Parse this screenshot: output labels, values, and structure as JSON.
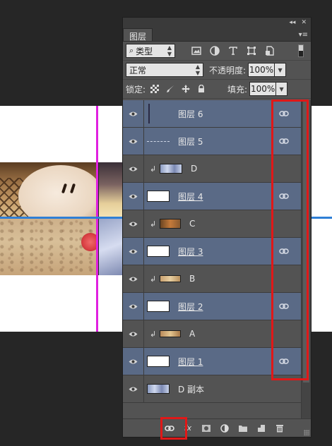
{
  "panel": {
    "tab_label": "图层",
    "collapse_icon": "◂◂",
    "close_icon": "✕",
    "menu_icon": "▾≡"
  },
  "filter": {
    "kind_label": "类型",
    "kind_icon": "search-icon",
    "filter_icons": [
      "image-filter-icon",
      "adjustment-filter-icon",
      "type-filter-icon",
      "shape-filter-icon",
      "smart-object-filter-icon"
    ]
  },
  "blend": {
    "mode": "正常",
    "opacity_label": "不透明度:",
    "opacity_value": "100%"
  },
  "lock": {
    "label": "锁定:",
    "fill_label": "填充:",
    "fill_value": "100%"
  },
  "layers": [
    {
      "name": "图层 6",
      "thumb": "vline",
      "selected": true,
      "linked": true,
      "clipped": false,
      "underline": false
    },
    {
      "name": "图层 5",
      "thumb": "line",
      "selected": true,
      "linked": true,
      "clipped": false,
      "underline": false
    },
    {
      "name": "D",
      "thumb": "img-blue",
      "selected": false,
      "linked": false,
      "clipped": true,
      "underline": false
    },
    {
      "name": "图层 4",
      "thumb": "white",
      "selected": true,
      "linked": true,
      "clipped": false,
      "underline": true
    },
    {
      "name": "C",
      "thumb": "img-brown",
      "selected": false,
      "linked": false,
      "clipped": true,
      "underline": false
    },
    {
      "name": "图层 3",
      "thumb": "white",
      "selected": true,
      "linked": true,
      "clipped": false,
      "underline": true
    },
    {
      "name": "B",
      "thumb": "img-sand",
      "selected": false,
      "linked": false,
      "clipped": true,
      "underline": false
    },
    {
      "name": "图层 2",
      "thumb": "white",
      "selected": true,
      "linked": true,
      "clipped": false,
      "underline": true
    },
    {
      "name": "A",
      "thumb": "img-beach",
      "selected": false,
      "linked": false,
      "clipped": true,
      "underline": false
    },
    {
      "name": "图层 1",
      "thumb": "white",
      "selected": true,
      "linked": true,
      "clipped": false,
      "underline": true
    },
    {
      "name": "D 副本",
      "thumb": "img-blue",
      "selected": false,
      "linked": false,
      "clipped": false,
      "underline": false
    }
  ],
  "bottom_buttons": [
    {
      "name": "link-layers-button",
      "glyph": "link-icon"
    },
    {
      "name": "fx-button",
      "glyph": "fx"
    },
    {
      "name": "add-mask-button",
      "glyph": "mask-icon"
    },
    {
      "name": "new-adjustment-button",
      "glyph": "adjustment-icon"
    },
    {
      "name": "new-group-button",
      "glyph": "folder-icon"
    },
    {
      "name": "new-layer-button",
      "glyph": "new-layer-icon"
    },
    {
      "name": "delete-layer-button",
      "glyph": "trash-icon"
    }
  ],
  "colors": {
    "highlight": "#e01818",
    "selected_row": "#5a6a86",
    "panel_bg": "#535353",
    "guide_magenta": "#e020e0",
    "guide_blue": "#2f7fd6"
  }
}
